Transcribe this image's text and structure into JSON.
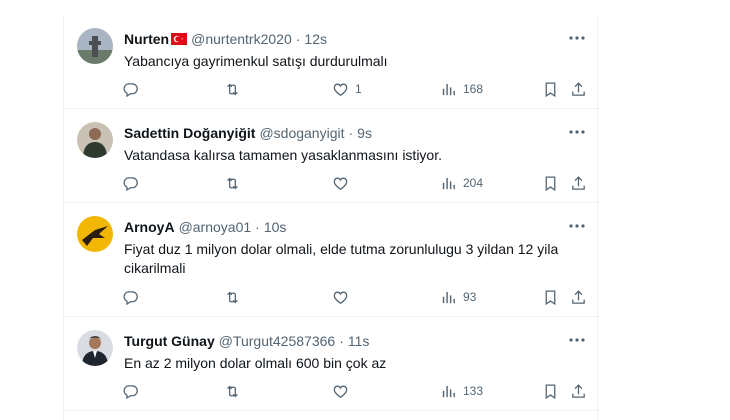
{
  "tweets": [
    {
      "name": "Nurten",
      "has_flag": true,
      "handle": "@nurtentrk2020",
      "dot": "·",
      "time": "12s",
      "text": "Yabancıya gayrimenkul satışı durdurulmalı",
      "likes": "1",
      "views": "168",
      "avatar_color": "#7a8a9a"
    },
    {
      "name": "Sadettin Doğanyiğit",
      "handle": "@sdoganyigit",
      "dot": "·",
      "time": "9s",
      "text": "Vatandasa kalırsa tamamen yasaklanmasını istiyor.",
      "likes": "",
      "views": "204",
      "avatar_color": "#3c4a3c"
    },
    {
      "name": "ArnoyA",
      "handle": "@arnoya01",
      "dot": "·",
      "time": "10s",
      "text": "Fiyat duz 1 milyon dolar olmali, elde tutma zorunlulugu 3 yildan 12 yila cikarilmali",
      "likes": "",
      "views": "93",
      "avatar_color": "#f2b705"
    },
    {
      "name": "Turgut Günay",
      "handle": "@Turgut42587366",
      "dot": "·",
      "time": "11s",
      "text": "En az 2 milyon dolar olmalı 600 bin çok az",
      "likes": "",
      "views": "133",
      "avatar_color": "#2a2f38"
    }
  ],
  "icons": {
    "reply": "reply-icon",
    "retweet": "retweet-icon",
    "like": "heart-icon",
    "views": "views-icon",
    "bookmark": "bookmark-icon",
    "share": "share-icon",
    "more": "more-icon"
  },
  "colors": {
    "text": "#0f1419",
    "secondary": "#536471",
    "border": "#eff3f4",
    "flag_red": "#e30a17"
  }
}
